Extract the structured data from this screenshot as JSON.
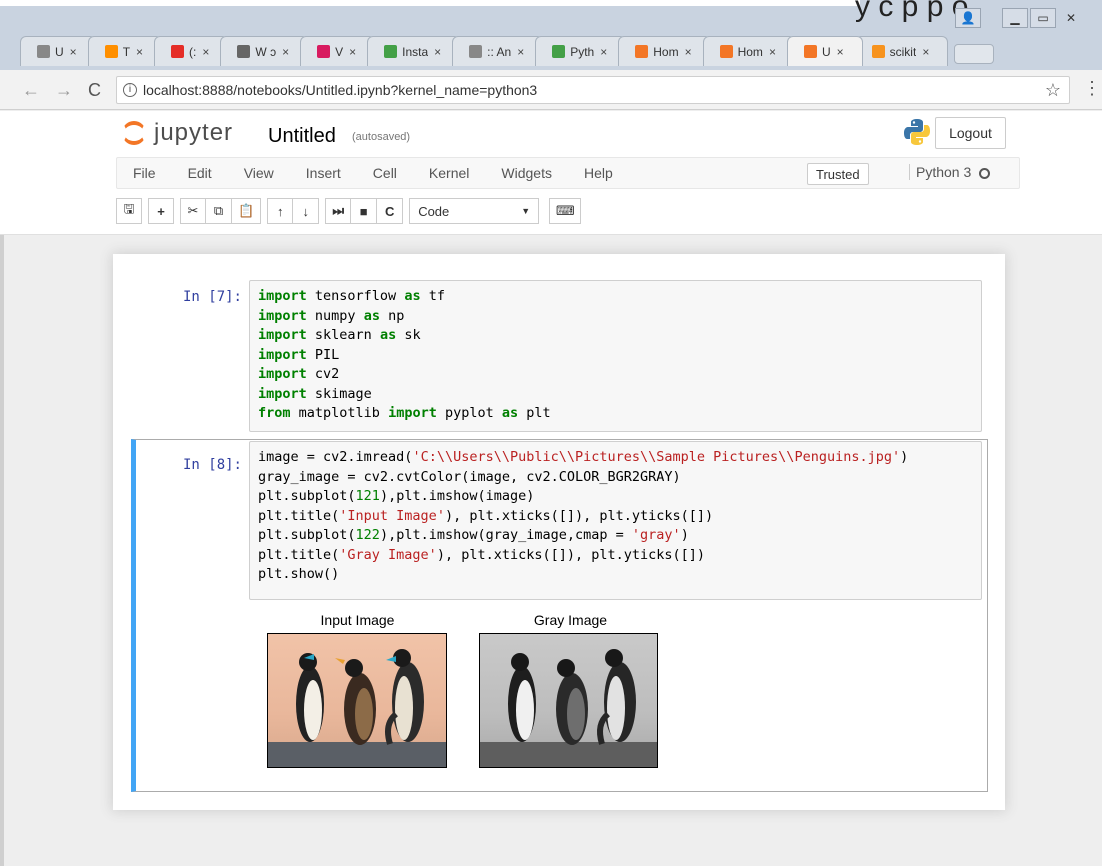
{
  "browser": {
    "top_text": "y c p p o",
    "tabs": [
      {
        "title": "U",
        "icon": "page-icon",
        "color": "#888888"
      },
      {
        "title": "T",
        "icon": "tensorflow-icon",
        "color": "#ff8f00"
      },
      {
        "title": "(:",
        "icon": "youtube-icon",
        "color": "#e52d27"
      },
      {
        "title": "W ɔ",
        "icon": "wikipedia-icon",
        "color": "#666666"
      },
      {
        "title": "V",
        "icon": "bars-icon",
        "color": "#d81b60"
      },
      {
        "title": "Insta",
        "icon": "colored-circle-icon",
        "color": "#43a047"
      },
      {
        "title": ":: An",
        "icon": "page-icon",
        "color": "#888888"
      },
      {
        "title": "Pyth",
        "icon": "python-circle-icon",
        "color": "#43a047"
      },
      {
        "title": "Hom",
        "icon": "jupyter-icon",
        "color": "#f37626"
      },
      {
        "title": "Hom",
        "icon": "jupyter-icon",
        "color": "#f37626"
      },
      {
        "title": "U",
        "icon": "jupyter-icon",
        "color": "#f37626",
        "active": true
      },
      {
        "title": "scikit",
        "icon": "colored-circle-icon",
        "color": "#f7931e"
      }
    ],
    "url": "localhost:8888/notebooks/Untitled.ipynb?kernel_name=python3"
  },
  "jupyter": {
    "logo_text": "jupyter",
    "notebook_name": "Untitled",
    "autosave": "(autosaved)",
    "logout": "Logout",
    "menu": [
      "File",
      "Edit",
      "View",
      "Insert",
      "Cell",
      "Kernel",
      "Widgets",
      "Help"
    ],
    "trusted": "Trusted",
    "kernel": "Python 3",
    "cell_type": "Code"
  },
  "cells": [
    {
      "prompt": "In [7]:",
      "lines": [
        [
          [
            "kw",
            "import"
          ],
          [
            "",
            " tensorflow "
          ],
          [
            "kw",
            "as"
          ],
          [
            "",
            " tf"
          ]
        ],
        [
          [
            "kw",
            "import"
          ],
          [
            "",
            " numpy "
          ],
          [
            "kw",
            "as"
          ],
          [
            "",
            " np"
          ]
        ],
        [
          [
            "kw",
            "import"
          ],
          [
            "",
            " sklearn "
          ],
          [
            "kw",
            "as"
          ],
          [
            "",
            " sk"
          ]
        ],
        [
          [
            "kw",
            "import"
          ],
          [
            "",
            " PIL"
          ]
        ],
        [
          [
            "kw",
            "import"
          ],
          [
            "",
            " cv2"
          ]
        ],
        [
          [
            "kw",
            "import"
          ],
          [
            "",
            " skimage"
          ]
        ],
        [
          [
            "kw",
            "from"
          ],
          [
            "",
            " matplotlib "
          ],
          [
            "kw",
            "import"
          ],
          [
            "",
            " pyplot "
          ],
          [
            "kw",
            "as"
          ],
          [
            "",
            " plt"
          ]
        ]
      ]
    },
    {
      "prompt": "In [8]:",
      "lines": [
        [
          [
            "",
            "image = cv2.imread("
          ],
          [
            "str",
            "'C:\\\\Users\\\\Public\\\\Pictures\\\\Sample Pictures\\\\Penguins.jpg'"
          ],
          [
            "",
            ")"
          ]
        ],
        [
          [
            "",
            "gray_image = cv2.cvtColor(image, cv2.COLOR_BGR2GRAY)"
          ]
        ],
        [
          [
            "",
            "plt.subplot("
          ],
          [
            "num",
            "121"
          ],
          [
            "",
            "),plt.imshow(image)"
          ]
        ],
        [
          [
            "",
            "plt.title("
          ],
          [
            "str",
            "'Input Image'"
          ],
          [
            "",
            "), plt.xticks([]), plt.yticks([])"
          ]
        ],
        [
          [
            "",
            "plt.subplot("
          ],
          [
            "num",
            "122"
          ],
          [
            "",
            "),plt.imshow(gray_image,cmap = "
          ],
          [
            "str",
            "'gray'"
          ],
          [
            "",
            ")"
          ]
        ],
        [
          [
            "",
            "plt.title("
          ],
          [
            "str",
            "'Gray Image'"
          ],
          [
            "",
            "), plt.xticks([]), plt.yticks([])"
          ]
        ],
        [
          [
            "",
            "plt.show()"
          ]
        ]
      ],
      "outputs": {
        "left_title": "Input Image",
        "right_title": "Gray Image"
      }
    }
  ]
}
